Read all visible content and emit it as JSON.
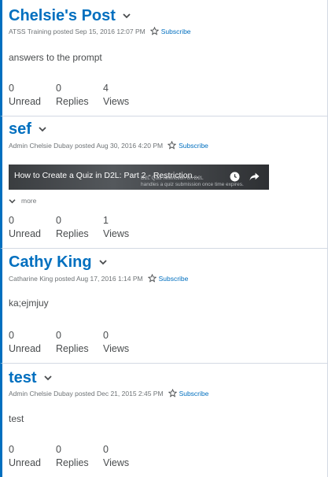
{
  "posts": [
    {
      "title": "Chelsie's Post",
      "meta": "ATSS Training posted Sep 15, 2016 12:07 PM",
      "subscribe_label": "Subscribe",
      "body": "answers to the prompt",
      "stats": [
        {
          "count": "0",
          "label": "Unread"
        },
        {
          "count": "0",
          "label": "Replies"
        },
        {
          "count": "4",
          "label": "Views"
        }
      ]
    },
    {
      "title": "sef",
      "meta": "Admin Chelsie Dubay posted Aug 30, 2016 4:20 PM",
      "subscribe_label": "Subscribe",
      "video": {
        "title": "How to Create a Quiz in D2L: Part 2 - Restriction...",
        "overlay_line1": "D2L Quiz restriction on D2L",
        "overlay_line2": "handles a quiz submission once time expires."
      },
      "more_label": "more",
      "stats": [
        {
          "count": "0",
          "label": "Unread"
        },
        {
          "count": "0",
          "label": "Replies"
        },
        {
          "count": "1",
          "label": "Views"
        }
      ]
    },
    {
      "title": "Cathy King",
      "meta": "Catharine King posted Aug 17, 2016 1:14 PM",
      "subscribe_label": "Subscribe",
      "body": "ka;ejmjuy",
      "stats": [
        {
          "count": "0",
          "label": "Unread"
        },
        {
          "count": "0",
          "label": "Replies"
        },
        {
          "count": "0",
          "label": "Views"
        }
      ]
    },
    {
      "title": "test",
      "meta": "Admin Chelsie Dubay posted Dec 21, 2015 2:45 PM",
      "subscribe_label": "Subscribe",
      "body": "test",
      "stats": [
        {
          "count": "0",
          "label": "Unread"
        },
        {
          "count": "0",
          "label": "Replies"
        },
        {
          "count": "0",
          "label": "Views"
        }
      ]
    }
  ],
  "colors": {
    "accent": "#006fbf",
    "text": "#494c4e",
    "muted": "#6e7376",
    "divider": "#d3d9e3"
  },
  "icons": {
    "chevron": "chevron-down-icon",
    "star": "star-icon",
    "clock": "watch-later-icon",
    "share": "share-icon"
  }
}
